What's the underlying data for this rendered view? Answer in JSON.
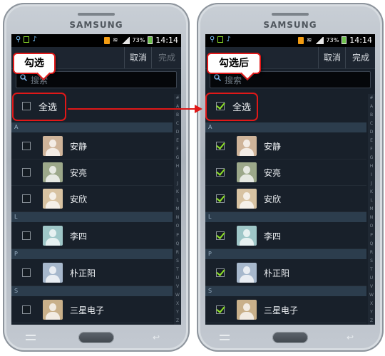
{
  "callouts": {
    "before": "勾选",
    "after": "勾选后"
  },
  "phones": [
    {
      "brand": "SAMSUNG",
      "status": {
        "battery": "73%",
        "time": "14:14"
      },
      "actionbar": {
        "cancel": "取消",
        "done": "完成"
      },
      "search": {
        "placeholder": "搜索"
      },
      "select_all": {
        "label": "全选",
        "checked": false
      },
      "sections": [
        "A",
        "L",
        "P",
        "S"
      ],
      "contacts": [
        {
          "name": "安静",
          "section": "A",
          "checked": false,
          "avatar_color": "#cfb49a"
        },
        {
          "name": "安亮",
          "section": "A",
          "checked": false,
          "avatar_color": "#9ca88a"
        },
        {
          "name": "安欣",
          "section": "A",
          "checked": false,
          "avatar_color": "#d8c3a2"
        },
        {
          "name": "李四",
          "section": "L",
          "checked": false,
          "avatar_color": "#9fc7c8"
        },
        {
          "name": "朴正阳",
          "section": "P",
          "checked": false,
          "avatar_color": "#a7b8cc"
        },
        {
          "name": "三星电子",
          "section": "S",
          "checked": false,
          "avatar_color": "#c9b08a"
        }
      ]
    },
    {
      "brand": "SAMSUNG",
      "status": {
        "battery": "73%",
        "time": "14:14"
      },
      "actionbar": {
        "cancel": "取消",
        "done": "完成"
      },
      "search": {
        "placeholder": "搜索"
      },
      "select_all": {
        "label": "全选",
        "checked": true
      },
      "sections": [
        "A",
        "L",
        "P",
        "S"
      ],
      "contacts": [
        {
          "name": "安静",
          "section": "A",
          "checked": true,
          "avatar_color": "#cfb49a"
        },
        {
          "name": "安亮",
          "section": "A",
          "checked": true,
          "avatar_color": "#9ca88a"
        },
        {
          "name": "安欣",
          "section": "A",
          "checked": true,
          "avatar_color": "#d8c3a2"
        },
        {
          "name": "李四",
          "section": "L",
          "checked": true,
          "avatar_color": "#9fc7c8"
        },
        {
          "name": "朴正阳",
          "section": "P",
          "checked": true,
          "avatar_color": "#a7b8cc"
        },
        {
          "name": "三星电子",
          "section": "S",
          "checked": true,
          "avatar_color": "#c9b08a"
        }
      ]
    }
  ],
  "index_letters": [
    "#",
    "A",
    "B",
    "C",
    "D",
    "E",
    "F",
    "G",
    "H",
    "I",
    "J",
    "K",
    "L",
    "M",
    "N",
    "O",
    "P",
    "Q",
    "R",
    "S",
    "T",
    "U",
    "V",
    "W",
    "X",
    "Y",
    "Z"
  ],
  "colors": {
    "accent": "#e01818",
    "check": "#8ee02a",
    "screen_bg": "#18202a",
    "section_bg": "#2c3d4d"
  }
}
